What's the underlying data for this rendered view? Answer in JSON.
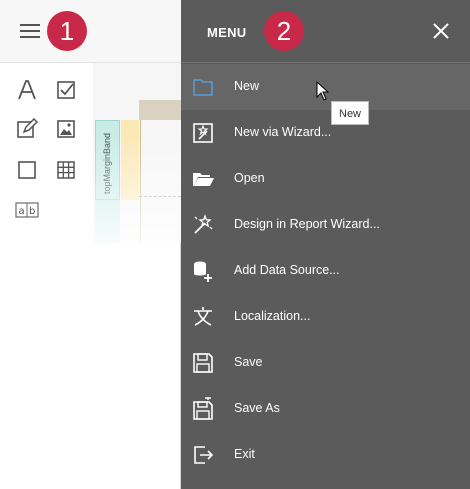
{
  "badges": {
    "first": "1",
    "second": "2"
  },
  "toolbox": {
    "tools": [
      "label-tool",
      "checkbox-tool",
      "richtext-tool",
      "picture-tool",
      "shape-tool",
      "table-tool",
      "character-comb-tool"
    ],
    "band_label": "topMarginBand"
  },
  "menu": {
    "title": "MENU",
    "items": [
      {
        "label": "New",
        "icon": "new-document-icon"
      },
      {
        "label": "New via Wizard...",
        "icon": "wizard-new-icon"
      },
      {
        "label": "Open",
        "icon": "folder-open-icon"
      },
      {
        "label": "Design in Report Wizard...",
        "icon": "magic-wand-icon"
      },
      {
        "label": "Add Data Source...",
        "icon": "add-data-source-icon"
      },
      {
        "label": "Localization...",
        "icon": "localization-icon"
      },
      {
        "label": "Save",
        "icon": "save-icon"
      },
      {
        "label": "Save As",
        "icon": "save-as-icon"
      },
      {
        "label": "Exit",
        "icon": "exit-icon"
      }
    ]
  },
  "tooltip": {
    "text": "New"
  },
  "colors": {
    "menu_bg": "#5b5b5b",
    "badge": "#c92849",
    "accent_blue": "#4a90d9"
  }
}
